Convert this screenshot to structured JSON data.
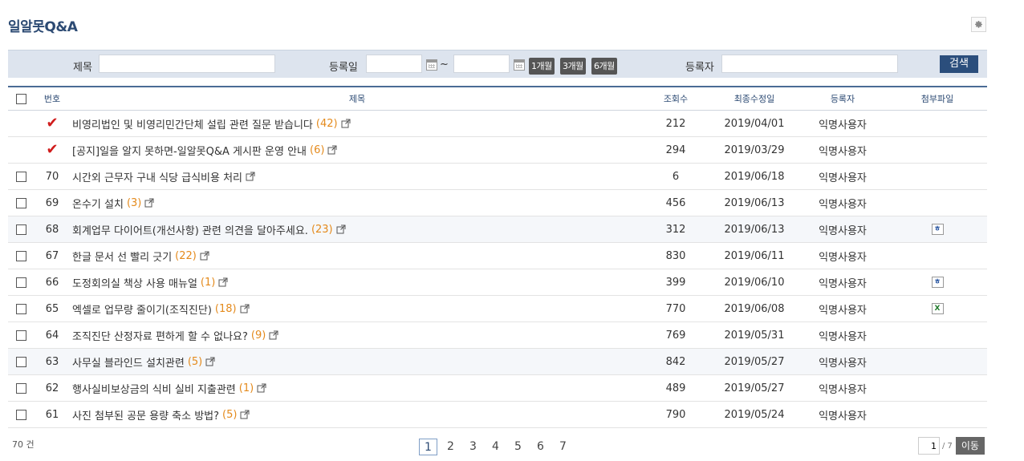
{
  "page": {
    "title": "일알못Q&A"
  },
  "search": {
    "subject_label": "제목",
    "date_label": "등록일",
    "tilde": "~",
    "periods": [
      "1개월",
      "3개월",
      "6개월"
    ],
    "author_label": "등록자",
    "search_button": "검색"
  },
  "table": {
    "headers": {
      "num": "번호",
      "subject": "제목",
      "views": "조회수",
      "modified": "최종수정일",
      "author": "등록자",
      "attachment": "첨부파일"
    },
    "rows": [
      {
        "notice": true,
        "num": "",
        "subject": "비영리법인 및 비영리민간단체 설립 관련 질문 받습니다",
        "comments": "(42)",
        "views": "212",
        "date": "2019/04/01",
        "author": "익명사용자",
        "file": ""
      },
      {
        "notice": true,
        "num": "",
        "subject": "[공지]일을 알지 못하면-일알못Q&A 게시판 운영 안내",
        "comments": "(6)",
        "views": "294",
        "date": "2019/03/29",
        "author": "익명사용자",
        "file": ""
      },
      {
        "notice": false,
        "num": "70",
        "subject": "시간외 근무자 구내 식당 급식비용 처리",
        "comments": "",
        "views": "6",
        "date": "2019/06/18",
        "author": "익명사용자",
        "file": ""
      },
      {
        "notice": false,
        "num": "69",
        "subject": "온수기 설치",
        "comments": "(3)",
        "views": "456",
        "date": "2019/06/13",
        "author": "익명사용자",
        "file": ""
      },
      {
        "notice": false,
        "num": "68",
        "subject": "회계업무 다이어트(개선사항) 관련 의견을 달아주세요.",
        "comments": "(23)",
        "views": "312",
        "date": "2019/06/13",
        "author": "익명사용자",
        "file": "hwp"
      },
      {
        "notice": false,
        "num": "67",
        "subject": "한글 문서 선 빨리 긋기",
        "comments": "(22)",
        "views": "830",
        "date": "2019/06/11",
        "author": "익명사용자",
        "file": ""
      },
      {
        "notice": false,
        "num": "66",
        "subject": "도정회의실 책상 사용 매뉴얼",
        "comments": "(1)",
        "views": "399",
        "date": "2019/06/10",
        "author": "익명사용자",
        "file": "hwp"
      },
      {
        "notice": false,
        "num": "65",
        "subject": "엑셀로 업무량 줄이기(조직진단)",
        "comments": "(18)",
        "views": "770",
        "date": "2019/06/08",
        "author": "익명사용자",
        "file": "xls"
      },
      {
        "notice": false,
        "num": "64",
        "subject": "조직진단 산정자료 편하게 할 수 없나요?",
        "comments": "(9)",
        "views": "769",
        "date": "2019/05/31",
        "author": "익명사용자",
        "file": ""
      },
      {
        "notice": false,
        "num": "63",
        "subject": "사무실 블라인드 설치관련",
        "comments": "(5)",
        "views": "842",
        "date": "2019/05/27",
        "author": "익명사용자",
        "file": ""
      },
      {
        "notice": false,
        "num": "62",
        "subject": "행사실비보상금의 식비 실비 지출관련",
        "comments": "(1)",
        "views": "489",
        "date": "2019/05/27",
        "author": "익명사용자",
        "file": ""
      },
      {
        "notice": false,
        "num": "61",
        "subject": "사진 첨부된 공문 용량 축소 방법?",
        "comments": "(5)",
        "views": "790",
        "date": "2019/05/24",
        "author": "익명사용자",
        "file": ""
      }
    ],
    "alt_rows": [
      4,
      9
    ]
  },
  "footer": {
    "total": "70 건",
    "pages": [
      "1",
      "2",
      "3",
      "4",
      "5",
      "6",
      "7"
    ],
    "current_page": "1",
    "page_input": "1",
    "page_total": "/ 7",
    "go_button": "이동"
  }
}
